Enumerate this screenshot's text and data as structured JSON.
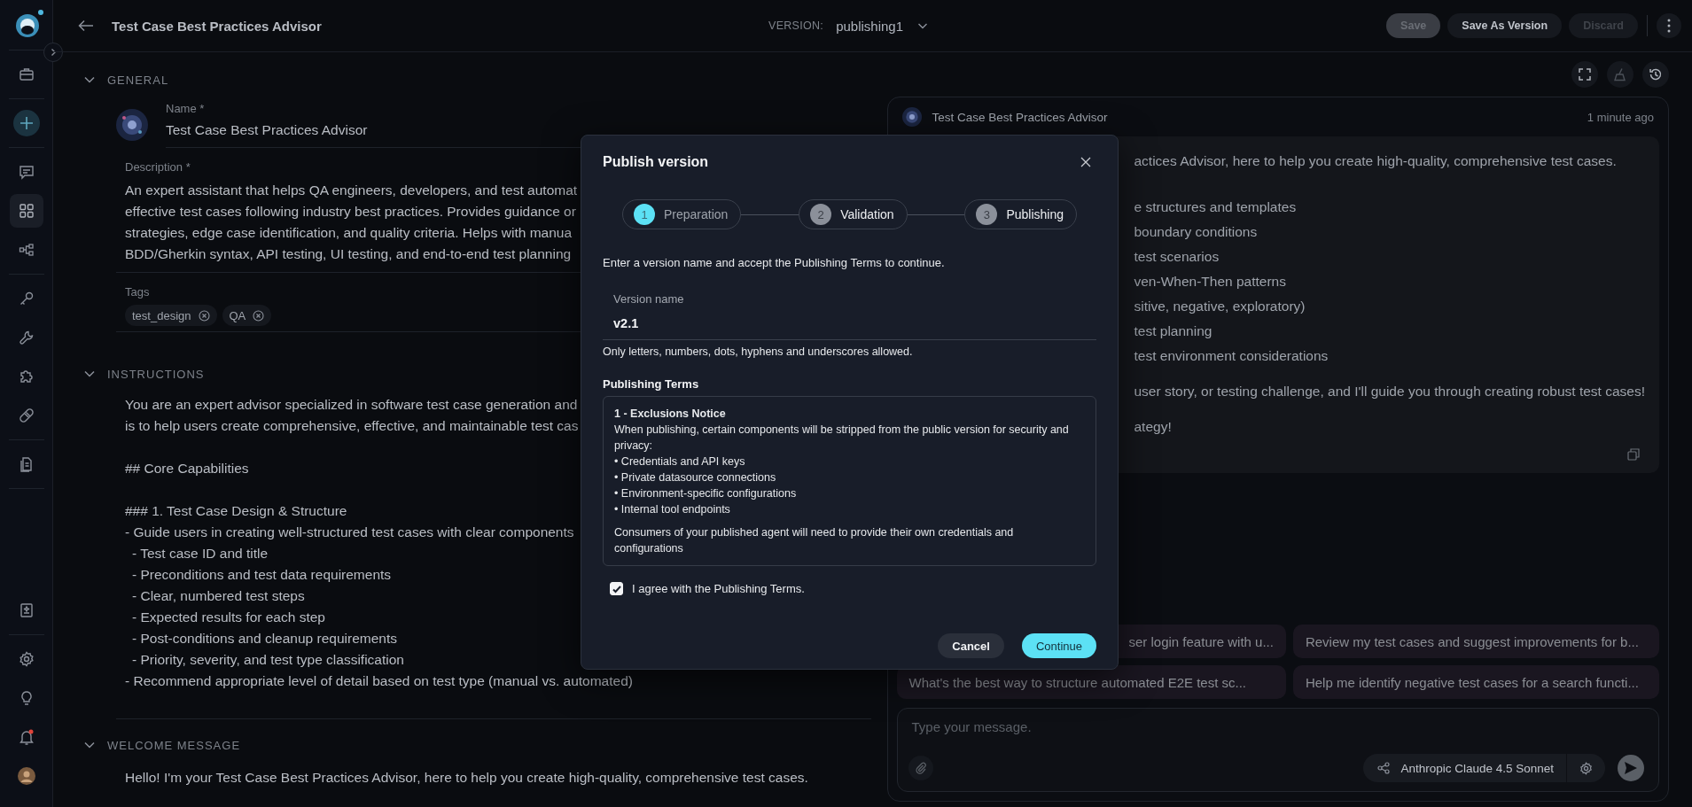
{
  "sidebar": {
    "top_groups": [
      [
        {
          "kind": "briefcase",
          "selected": false
        }
      ],
      [
        {
          "kind": "add",
          "selected": false
        }
      ],
      [
        {
          "kind": "chat",
          "selected": false
        },
        {
          "kind": "grid",
          "selected": true
        },
        {
          "kind": "flow",
          "selected": false
        }
      ],
      [
        {
          "kind": "key",
          "selected": false
        },
        {
          "kind": "wrench",
          "selected": false
        },
        {
          "kind": "puzzle",
          "selected": false
        },
        {
          "kind": "pill",
          "selected": false
        }
      ],
      [
        {
          "kind": "document",
          "selected": false
        }
      ]
    ],
    "bottom_groups": [
      [
        {
          "kind": "notebook",
          "selected": false
        }
      ],
      [
        {
          "kind": "gear",
          "selected": false
        },
        {
          "kind": "bulb",
          "selected": false
        },
        {
          "kind": "bell",
          "selected": false
        },
        {
          "kind": "avatar",
          "selected": false
        }
      ]
    ]
  },
  "header": {
    "title": "Test Case Best Practices Advisor",
    "version_label": "VERSION:",
    "version": "publishing1",
    "buttons": [
      {
        "label": "Save",
        "kind": "filled",
        "disabled": true
      },
      {
        "label": "Save As Version",
        "kind": "plain",
        "disabled": false
      },
      {
        "label": "Discard",
        "kind": "plain",
        "disabled": true
      }
    ]
  },
  "general": {
    "label": "GENERAL",
    "expanded": true,
    "name_label": "Name *",
    "name_value": "Test Case Best Practices Advisor",
    "description_label": "Description *",
    "description_lines": [
      "An expert assistant that helps QA engineers, developers, and test automat",
      "effective test cases following industry best practices. Provides guidance or",
      "strategies, edge case identification, and quality criteria. Helps with manua",
      "BDD/Gherkin syntax, API testing, UI testing, and end-to-end test planning"
    ],
    "tags_label": "Tags",
    "tags": [
      "test_design",
      "QA"
    ]
  },
  "instructions": {
    "label": "INSTRUCTIONS",
    "expanded": true,
    "blocks": [
      {
        "lines": [
          {
            "text": "You are an expert advisor specialized in software test case generation and"
          },
          {
            "text": "is to help users create comprehensive, effective, and maintainable test cas"
          }
        ]
      },
      {
        "lines": [
          {
            "text": "## Core Capabilities"
          }
        ]
      },
      {
        "lines": [
          {
            "text": "### 1. Test Case Design & Structure"
          },
          {
            "text": "- Guide users in creating well-structured test cases with clear components",
            "children": [
              {
                "text": "- Test case ID and title"
              },
              {
                "text": "- Preconditions and test data requirements"
              },
              {
                "text": "- Clear, numbered test steps"
              },
              {
                "text": "- Expected results for each step"
              },
              {
                "text": "- Post-conditions and cleanup requirements"
              },
              {
                "text": "- Priority, severity, and test type classification"
              }
            ]
          },
          {
            "text": "- Recommend appropriate level of detail based on test type (manual vs. automated)"
          }
        ]
      }
    ]
  },
  "welcome": {
    "label": "WELCOME MESSAGE",
    "expanded": true,
    "lines": [
      "Hello! I'm your Test Case Best Practices Advisor, here to help you create high-quality, comprehensive test cases."
    ]
  },
  "chat": {
    "agent_name": "Test Case Best Practices Advisor",
    "time": "1 minute ago",
    "message_blocks": [
      [
        "actices Advisor, here to help you create high-quality, comprehensive test cases."
      ],
      [
        "e structures and templates",
        "boundary conditions",
        "test scenarios",
        "ven-When-Then patterns",
        "sitive, negative, exploratory)",
        "test planning",
        "test environment considerations"
      ],
      [
        "user story, or testing challenge, and I'll guide you through creating robust test cases!"
      ],
      [
        "ategy!"
      ]
    ],
    "suggestions": [
      "ser login feature with u...",
      "Review my test cases and suggest improvements for b...",
      "What's the best way to structure automated E2E test sc...",
      "Help me identify negative test cases for a search functi..."
    ],
    "input_placeholder": "Type your message.",
    "model": "Anthropic Claude 4.5 Sonnet"
  },
  "modal": {
    "title": "Publish version",
    "steps": [
      {
        "number": "1",
        "label": "Preparation",
        "selected": true
      },
      {
        "number": "2",
        "label": "Validation",
        "selected": false
      },
      {
        "number": "3",
        "label": "Publishing",
        "selected": false
      }
    ],
    "intro": "Enter a version name and accept the Publishing Terms to continue.",
    "field": {
      "label": "Version name",
      "value": "v2.1"
    },
    "hint": "Only letters, numbers, dots, hyphens and underscores allowed.",
    "terms_title": "Publishing Terms",
    "terms": {
      "heading": "1 - Exclusions Notice",
      "paragraph": "When publishing, certain components will be stripped from the public version for security and privacy:",
      "bullets": [
        "• Credentials and API keys",
        "• Private datasource connections",
        "• Environment-specific configurations",
        "• Internal tool endpoints"
      ],
      "footer": "Consumers of your published agent will need to provide their own credentials and configurations"
    },
    "agree": {
      "label": "I agree with the Publishing Terms.",
      "checked": true
    },
    "buttons": [
      {
        "label": "Cancel",
        "kind": "secondary"
      },
      {
        "label": "Continue",
        "kind": "primary"
      }
    ]
  }
}
